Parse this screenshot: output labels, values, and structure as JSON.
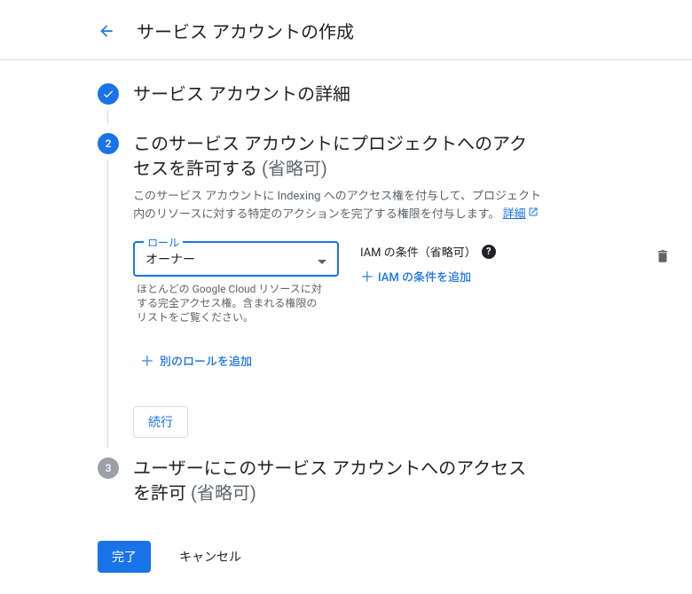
{
  "header": {
    "title": "サービス アカウントの作成"
  },
  "steps": {
    "step1": {
      "title": "サービス アカウントの詳細"
    },
    "step2": {
      "number": "2",
      "title_prefix": "このサービス アカウントにプロジェクトへのアクセスを許可する ",
      "optional": "(省略可)",
      "description_a": "このサービス アカウントに Indexing へのアクセス権を付与して、プロジェクト内のリソースに対する特定のアクションを完了する権限を付与します。",
      "details_link": "詳細",
      "role": {
        "label": "ロール",
        "value": "オーナー",
        "help": "ほとんどの Google Cloud リソースに対する完全アクセス権。含まれる権限のリストをご覧ください。"
      },
      "condition": {
        "header": "IAM の条件（省略可）",
        "add_label": "IAM の条件を追加"
      },
      "add_role": "別のロールを追加",
      "continue": "続行"
    },
    "step3": {
      "number": "3",
      "title_prefix": "ユーザーにこのサービス アカウントへのアクセスを許可 ",
      "optional": "(省略可)"
    }
  },
  "footer": {
    "done": "完了",
    "cancel": "キャンセル"
  }
}
